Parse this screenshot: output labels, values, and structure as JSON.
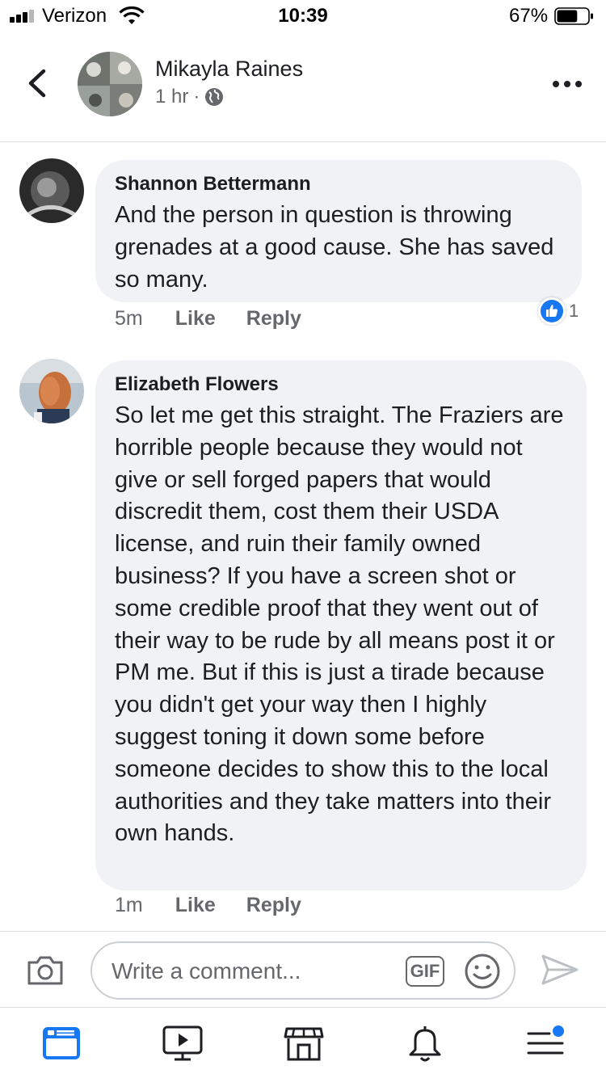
{
  "status_bar": {
    "carrier": "Verizon",
    "time": "10:39",
    "battery": "67%",
    "battery_level": 0.67,
    "signal_bars": 3
  },
  "post_header": {
    "author": "Mikayla Raines",
    "time": "1 hr",
    "separator": "·",
    "audience_icon": "globe-icon"
  },
  "comments": [
    {
      "author": "Shannon Bettermann",
      "text": "And the person in question is throwing grenades at a good cause. She has saved so many.",
      "time": "5m",
      "like_label": "Like",
      "reply_label": "Reply",
      "reaction_icon": "thumbs-up-icon",
      "reaction_count": "1"
    },
    {
      "author": "Elizabeth Flowers",
      "text": "So let me get this straight. The Fraziers are horrible people because they would not give or sell forged papers that would discredit them, cost them their USDA license, and ruin their family owned business? If you have a screen shot or some credible proof that they went out of their way to be rude by all means post it or PM me. But if this is just a tirade because you didn't get your way then I highly suggest toning it down some before someone decides to show this to the local authorities and they take matters into their own hands.",
      "time": "1m",
      "like_label": "Like",
      "reply_label": "Reply"
    }
  ],
  "composer": {
    "placeholder": "Write a comment...",
    "value": "",
    "gif_label": "GIF"
  },
  "tab_bar": {
    "items": [
      "news-feed-icon",
      "watch-icon",
      "marketplace-icon",
      "notifications-icon",
      "menu-icon"
    ],
    "active": "news-feed-icon"
  },
  "colors": {
    "accent": "#1877f2",
    "bubble": "#f0f2f5",
    "secondary_text": "#65676b"
  }
}
